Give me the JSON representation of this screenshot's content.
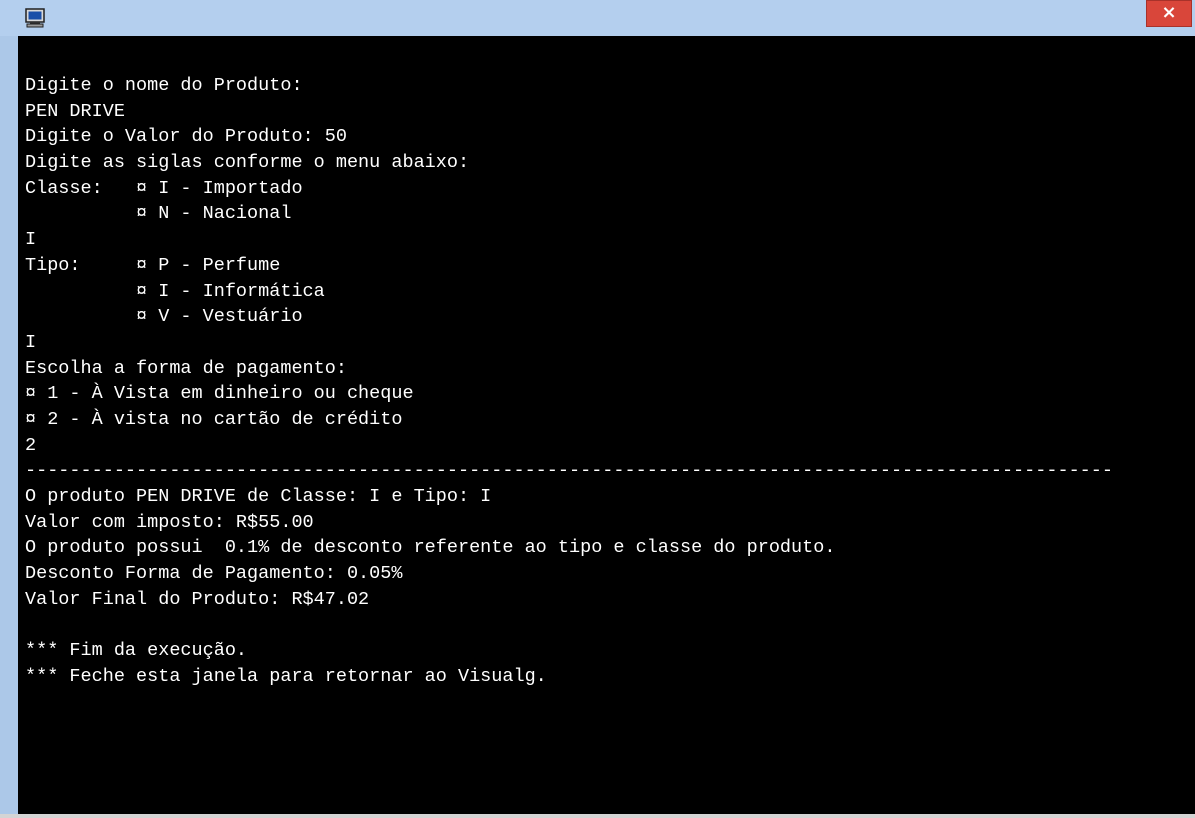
{
  "window": {
    "icon": "console-app-icon",
    "close_label": "×"
  },
  "console": {
    "lines": [
      "Digite o nome do Produto:",
      "PEN DRIVE",
      "Digite o Valor do Produto: 50",
      "Digite as siglas conforme o menu abaixo:",
      "Classe:   ¤ I - Importado",
      "          ¤ N - Nacional",
      "I",
      "Tipo:     ¤ P - Perfume",
      "          ¤ I - Informática",
      "          ¤ V - Vestuário",
      "I",
      "Escolha a forma de pagamento:",
      "¤ 1 - À Vista em dinheiro ou cheque",
      "¤ 2 - À vista no cartão de crédito",
      "2",
      "--------------------------------------------------------------------------------------------------",
      "O produto PEN DRIVE de Classe: I e Tipo: I",
      "Valor com imposto: R$55.00",
      "O produto possui  0.1% de desconto referente ao tipo e classe do produto.",
      "Desconto Forma de Pagamento: 0.05%",
      "Valor Final do Produto: R$47.02",
      "",
      "*** Fim da execução.",
      "*** Feche esta janela para retornar ao Visualg."
    ]
  },
  "colors": {
    "titlebar": "#b4cfee",
    "console_bg": "#000000",
    "console_text": "#ffffff",
    "close_button": "#d9463a"
  }
}
